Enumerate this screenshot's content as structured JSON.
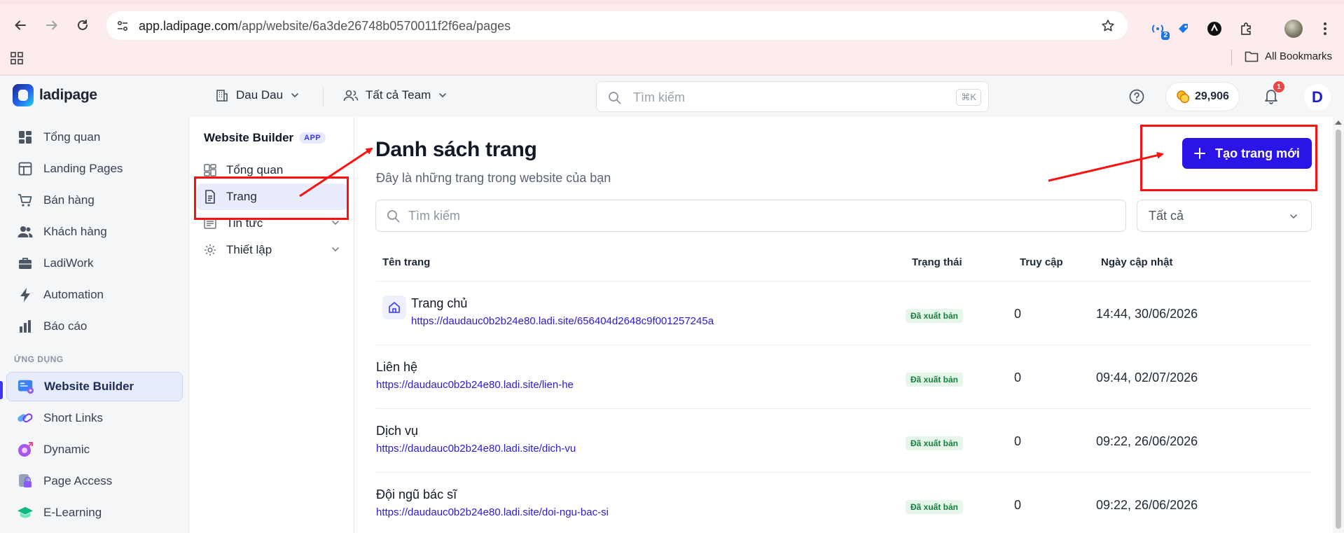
{
  "browser": {
    "url_host": "app.ladipage.com",
    "url_path": "/app/website/6a3de26748b0570011f2f6ea/pages",
    "extension_badge": "2",
    "bookmarks_label": "All Bookmarks"
  },
  "header": {
    "logo_text": "ladipage",
    "workspace": "Dau Dau",
    "team": "Tất cả Team",
    "search_placeholder": "Tìm kiếm",
    "search_shortcut": "⌘K",
    "coins": "29,906",
    "notifications": "1",
    "user_initial": "D"
  },
  "sidebar": {
    "items": [
      {
        "label": "Tổng quan",
        "icon": "dashboard-icon"
      },
      {
        "label": "Landing Pages",
        "icon": "layout-icon"
      },
      {
        "label": "Bán hàng",
        "icon": "cart-icon"
      },
      {
        "label": "Khách hàng",
        "icon": "users-icon"
      },
      {
        "label": "LadiWork",
        "icon": "briefcase-icon"
      },
      {
        "label": "Automation",
        "icon": "bolt-icon"
      },
      {
        "label": "Báo cáo",
        "icon": "bar-chart-icon"
      }
    ],
    "section_label": "ỨNG DỤNG",
    "apps": [
      {
        "label": "Website Builder",
        "icon": "website-builder-icon",
        "active": true
      },
      {
        "label": "Short Links",
        "icon": "link-icon"
      },
      {
        "label": "Dynamic",
        "icon": "dynamic-icon"
      },
      {
        "label": "Page Access",
        "icon": "lock-icon"
      },
      {
        "label": "E-Learning",
        "icon": "graduation-icon"
      }
    ]
  },
  "subnav": {
    "title": "Website Builder",
    "tag": "APP",
    "items": [
      {
        "label": "Tổng quan"
      },
      {
        "label": "Trang"
      },
      {
        "label": "Tin tức"
      },
      {
        "label": "Thiết lập"
      }
    ]
  },
  "main": {
    "title": "Danh sách trang",
    "subtitle": "Đây là những trang trong website của bạn",
    "new_button": "Tạo trang mới",
    "search_placeholder": "Tìm kiếm",
    "filter_value": "Tất cả",
    "columns": [
      "Tên trang",
      "Trạng thái",
      "Truy cập",
      "Ngày cập nhật"
    ],
    "rows": [
      {
        "name": "Trang chủ",
        "url": "https://daudauc0b2b24e80.ladi.site/656404d2648c9f001257245a",
        "status": "Đã xuất bản",
        "visits": "0",
        "updated": "14:44, 30/06/2026"
      },
      {
        "name": "Liên hệ",
        "url": "https://daudauc0b2b24e80.ladi.site/lien-he",
        "status": "Đã xuất bản",
        "visits": "0",
        "updated": "09:44, 02/07/2026"
      },
      {
        "name": "Dịch vụ",
        "url": "https://daudauc0b2b24e80.ladi.site/dich-vu",
        "status": "Đã xuất bản",
        "visits": "0",
        "updated": "09:22, 26/06/2026"
      },
      {
        "name": "Đội ngũ bác sĩ",
        "url": "https://daudauc0b2b24e80.ladi.site/doi-ngu-bac-si",
        "status": "Đã xuất bản",
        "visits": "0",
        "updated": "09:22, 26/06/2026"
      }
    ]
  },
  "colors": {
    "primary": "#2a14e8",
    "annotation": "#ff1010",
    "status_bg": "#e6f6ea",
    "status_text": "#15803d"
  }
}
